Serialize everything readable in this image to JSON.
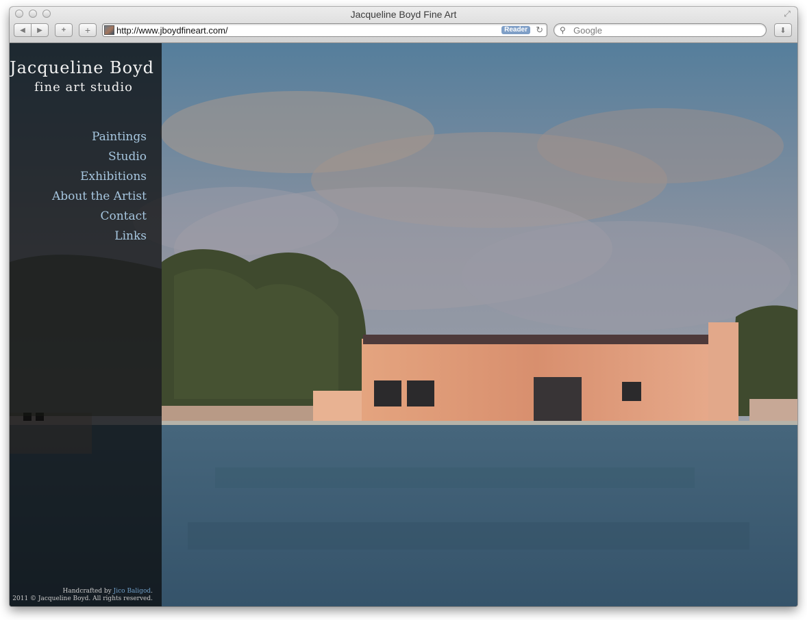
{
  "browser": {
    "window_title": "Jacqueline Boyd Fine Art",
    "url": "http://www.jboydfineart.com/",
    "reader_label": "Reader",
    "search_placeholder": "Google"
  },
  "site": {
    "logo_name": "Jacqueline Boyd",
    "logo_tagline": "fine art studio",
    "menu": [
      {
        "label": "Paintings"
      },
      {
        "label": "Studio"
      },
      {
        "label": "Exhibitions"
      },
      {
        "label": "About the Artist"
      },
      {
        "label": "Contact"
      },
      {
        "label": "Links"
      }
    ],
    "footer": {
      "credit_prefix": "Handcrafted by ",
      "credit_name": "Jico Baligod",
      "credit_suffix": ".",
      "copyright": "2011 © Jacqueline Boyd. All rights reserved."
    }
  },
  "colors": {
    "menu_link": "#a7c7e0",
    "sidebar_bg": "#080808",
    "sky": "#7a8a9c",
    "building": "#d99a7a",
    "water": "#3c5b70",
    "trees": "#3e4a2c"
  }
}
